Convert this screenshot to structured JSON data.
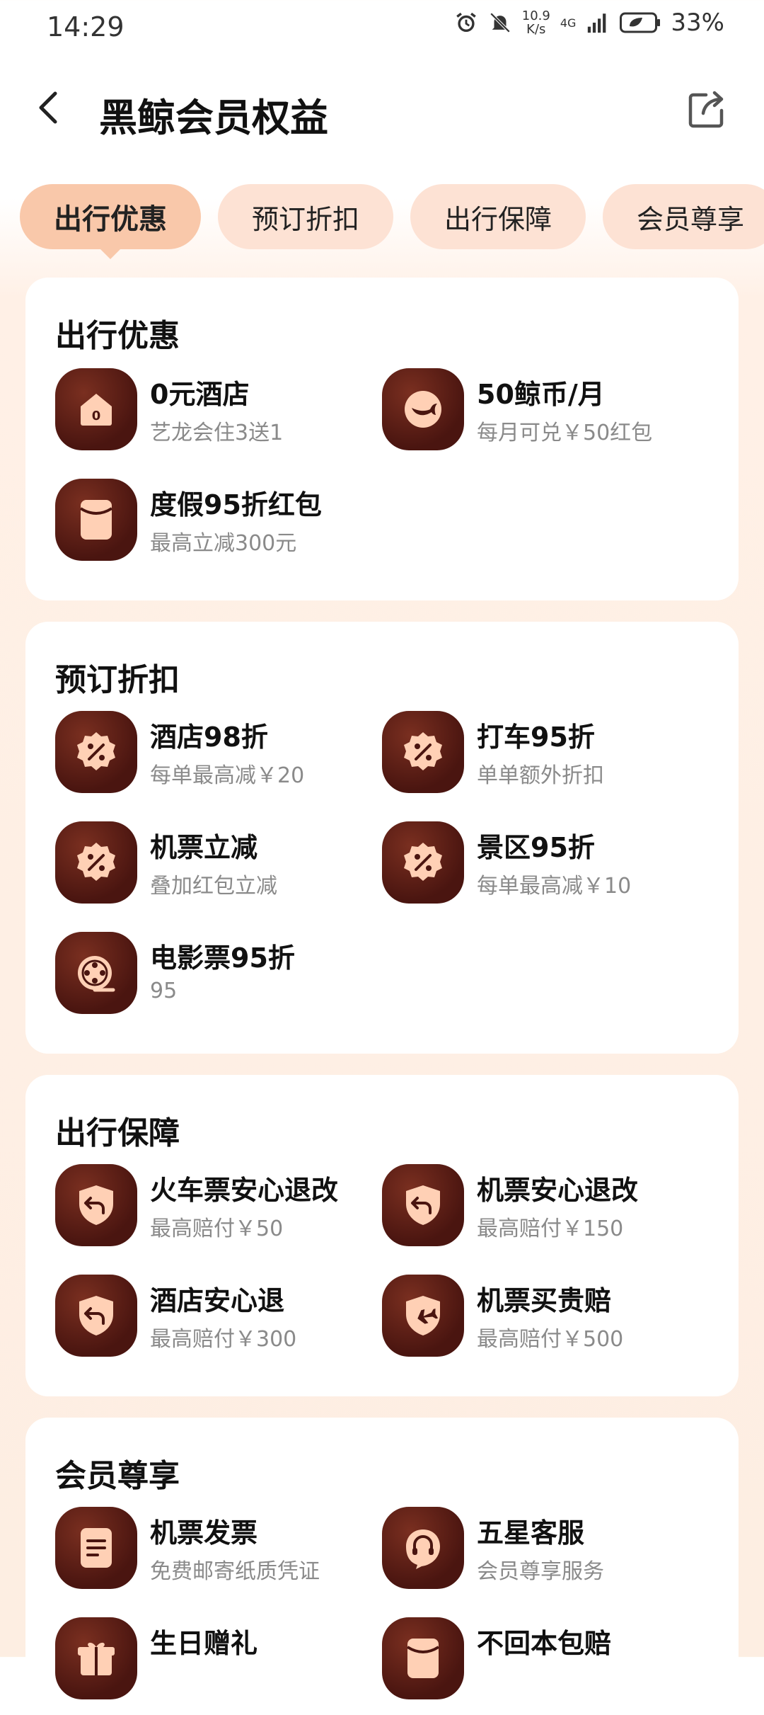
{
  "status_bar": {
    "time": "14:29",
    "net_speed_top": "10.9",
    "net_speed_bottom": "K/s",
    "network_type": "4G",
    "battery": "33%"
  },
  "header": {
    "title": "黑鲸会员权益"
  },
  "tabs": [
    {
      "label": "出行优惠",
      "active": true
    },
    {
      "label": "预订折扣",
      "active": false
    },
    {
      "label": "出行保障",
      "active": false
    },
    {
      "label": "会员尊享",
      "active": false
    }
  ],
  "sections": [
    {
      "title": "出行优惠",
      "items": [
        {
          "name": "0元酒店",
          "desc": "艺龙会住3送1",
          "icon": "hotel-icon"
        },
        {
          "name": "50鲸币/月",
          "desc": "每月可兑￥50红包",
          "icon": "whale-coin-icon"
        },
        {
          "name": "度假95折红包",
          "desc": "最高立减300元",
          "icon": "red-packet-icon"
        }
      ]
    },
    {
      "title": "预订折扣",
      "items": [
        {
          "name": "酒店98折",
          "desc": "每单最高减￥20",
          "icon": "discount-icon"
        },
        {
          "name": "打车95折",
          "desc": "单单额外折扣",
          "icon": "discount-icon"
        },
        {
          "name": "机票立减",
          "desc": "叠加红包立减",
          "icon": "discount-icon"
        },
        {
          "name": "景区95折",
          "desc": "每单最高减￥10",
          "icon": "discount-icon"
        },
        {
          "name": "电影票95折",
          "desc": "95",
          "icon": "film-reel-icon"
        }
      ]
    },
    {
      "title": "出行保障",
      "items": [
        {
          "name": "火车票安心退改",
          "desc": "最高赔付￥50",
          "icon": "shield-return-icon"
        },
        {
          "name": "机票安心退改",
          "desc": "最高赔付￥150",
          "icon": "shield-return-icon"
        },
        {
          "name": "酒店安心退",
          "desc": "最高赔付￥300",
          "icon": "shield-return-icon"
        },
        {
          "name": "机票买贵赔",
          "desc": "最高赔付￥500",
          "icon": "shield-plane-icon"
        }
      ]
    },
    {
      "title": "会员尊享",
      "items": [
        {
          "name": "机票发票",
          "desc": "免费邮寄纸质凭证",
          "icon": "invoice-icon"
        },
        {
          "name": "五星客服",
          "desc": "会员尊享服务",
          "icon": "headset-icon"
        },
        {
          "name": "生日赠礼",
          "desc": "",
          "icon": "gift-icon"
        },
        {
          "name": "不回本包赔",
          "desc": "",
          "icon": "red-packet-icon"
        }
      ]
    }
  ],
  "colors": {
    "icon_bg": "#4a1510",
    "icon_fg": "#ffd0b5",
    "tab_active": "#f9c8aa",
    "tab_inactive": "#fde2d4",
    "page_bg": "#fdeee2"
  }
}
